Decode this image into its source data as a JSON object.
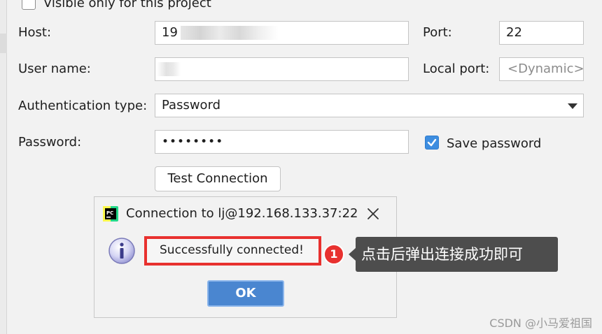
{
  "form": {
    "visible_only_label": "Visible only for this project",
    "host_label": "Host:",
    "host_value": "19",
    "port_label": "Port:",
    "port_value": "22",
    "username_label": "User name:",
    "username_value": "",
    "local_port_label": "Local port:",
    "local_port_placeholder": "<Dynamic>",
    "auth_type_label": "Authentication type:",
    "auth_type_value": "Password",
    "password_label": "Password:",
    "password_value": "••••••••",
    "save_password_label": "Save password",
    "save_password_checked": true,
    "test_connection_label": "Test Connection"
  },
  "dialog": {
    "title": "Connection to lj@192.168.133.37:22",
    "message": "Successfully connected!",
    "ok_label": "OK",
    "app_icon_name": "pycharm-icon",
    "info_icon_name": "info-icon"
  },
  "annotation": {
    "step_number": "1",
    "callout_text": "点击后弹出连接成功即可"
  },
  "watermark": "CSDN @小马爱祖国",
  "colors": {
    "accent": "#3d8de0",
    "ok_button": "#4a86d0",
    "highlight": "#e8312f",
    "callout_bg": "#4d4d4d"
  }
}
